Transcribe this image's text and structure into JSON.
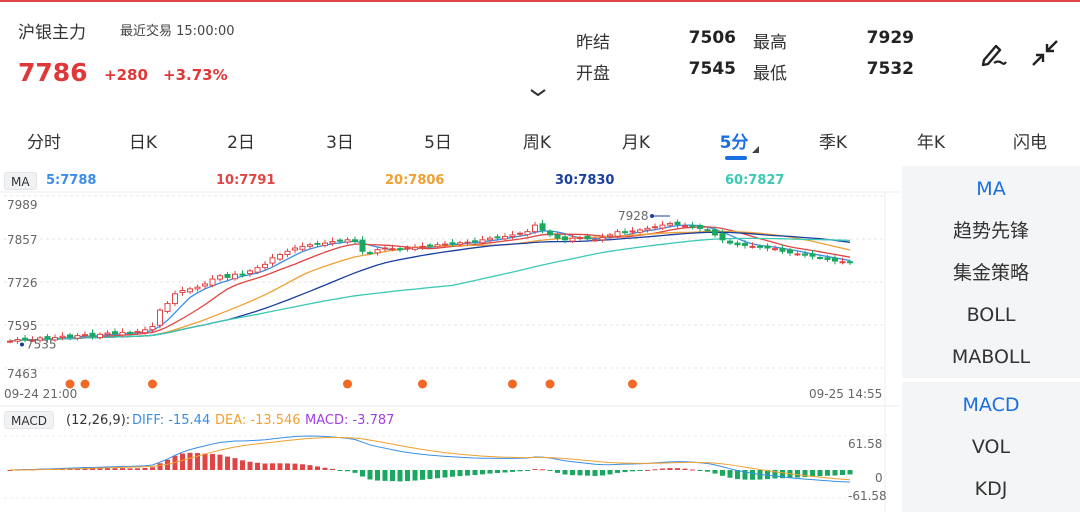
{
  "header": {
    "name": "沪银主力",
    "status": "最近交易 15:00:00",
    "price": "7786",
    "change": "+280",
    "change_pct": "+3.73%"
  },
  "stats": {
    "prev_settle_label": "昨结",
    "prev_settle": "7506",
    "high_label": "最高",
    "high": "7929",
    "open_label": "开盘",
    "open": "7545",
    "low_label": "最低",
    "low": "7532"
  },
  "toolbar": {
    "draw_icon": "pen-icon",
    "collapse_icon": "collapse-arrows-icon",
    "expand_icon": "chevron-down-icon"
  },
  "tabs": [
    "分时",
    "日K",
    "2日",
    "3日",
    "5日",
    "周K",
    "月K",
    "5分",
    "季K",
    "年K",
    "闪电"
  ],
  "active_tab": "5分",
  "ma_legend": {
    "badge": "MA",
    "items": [
      {
        "label": "5:7788",
        "color": "#3a8ee6"
      },
      {
        "label": "10:7791",
        "color": "#e04545"
      },
      {
        "label": "20:7806",
        "color": "#f0a030"
      },
      {
        "label": "30:7830",
        "color": "#1a3fa0"
      },
      {
        "label": "60:7827",
        "color": "#3cc8b4"
      }
    ]
  },
  "macd_legend": {
    "badge": "MACD",
    "params": "(12,26,9):",
    "diff": "DIFF: -15.44",
    "dea": "DEA: -13.546",
    "macd": "MACD: -3.787"
  },
  "side_panel": {
    "top": [
      "MA",
      "趋势先锋",
      "集金策略",
      "BOLL",
      "MABOLL"
    ],
    "bottom": [
      "MACD",
      "VOL",
      "KDJ"
    ]
  },
  "chart_data": {
    "type": "candlestick",
    "y_ticks": [
      "7989",
      "7857",
      "7726",
      "7595",
      "7463"
    ],
    "ylim": [
      7463,
      7989
    ],
    "x_start": "09-24 21:00",
    "x_end": "09-25 14:55",
    "high_marker": "7928",
    "low_marker": "7535",
    "close_series": [
      7545,
      7550,
      7552,
      7548,
      7555,
      7553,
      7556,
      7560,
      7558,
      7562,
      7565,
      7560,
      7566,
      7570,
      7568,
      7572,
      7570,
      7575,
      7580,
      7590,
      7640,
      7660,
      7690,
      7700,
      7705,
      7710,
      7720,
      7735,
      7745,
      7740,
      7750,
      7748,
      7760,
      7770,
      7780,
      7800,
      7810,
      7820,
      7830,
      7835,
      7840,
      7842,
      7845,
      7850,
      7852,
      7855,
      7850,
      7820,
      7815,
      7825,
      7830,
      7828,
      7825,
      7830,
      7832,
      7835,
      7838,
      7840,
      7842,
      7845,
      7846,
      7848,
      7850,
      7855,
      7860,
      7862,
      7865,
      7870,
      7875,
      7880,
      7900,
      7885,
      7870,
      7860,
      7855,
      7860,
      7862,
      7858,
      7855,
      7862,
      7870,
      7880,
      7878,
      7882,
      7885,
      7890,
      7895,
      7900,
      7905,
      7902,
      7898,
      7895,
      7890,
      7885,
      7870,
      7855,
      7845,
      7840,
      7838,
      7835,
      7832,
      7830,
      7828,
      7820,
      7815,
      7812,
      7808,
      7805,
      7800,
      7795,
      7790,
      7788,
      7786
    ],
    "macd_ylim": [
      -61.58,
      61.58
    ],
    "macd_ticks": [
      "61.58",
      "0",
      "-61.58"
    ],
    "markers": [
      "dot",
      "dot",
      "dot",
      "dot",
      "dot",
      "dot",
      "dot",
      "dot"
    ]
  }
}
